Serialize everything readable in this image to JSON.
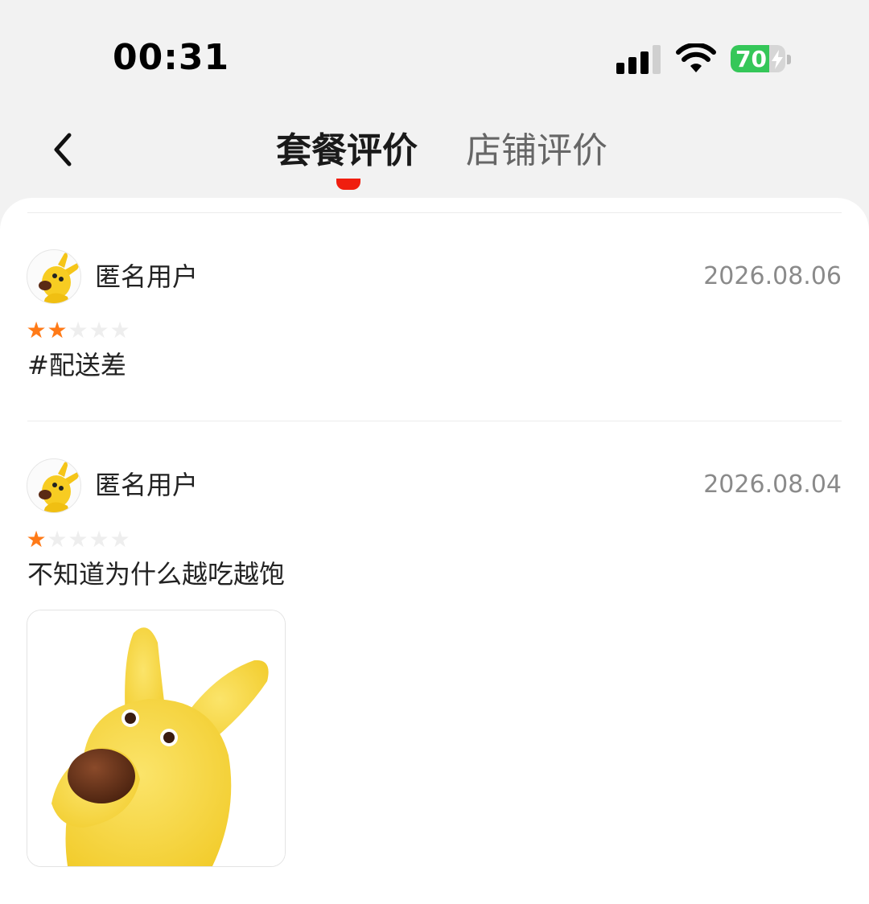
{
  "status_bar": {
    "time": "00:31",
    "battery_percent": 70,
    "battery_label": "70",
    "icons": [
      "signal-icon",
      "wifi-icon",
      "battery-icon",
      "charging-bolt-icon"
    ]
  },
  "nav": {
    "back_icon": "chevron-left-icon",
    "tabs": [
      {
        "label": "套餐评价",
        "active": true
      },
      {
        "label": "店铺评价",
        "active": false
      }
    ],
    "indicator_color": "#f01e0f"
  },
  "reviews": [
    {
      "user": "匿名用户",
      "date": "2026.08.06",
      "rating": 2,
      "max_rating": 5,
      "text": "#配送差"
    },
    {
      "user": "匿名用户",
      "date": "2026.08.04",
      "rating": 1,
      "max_rating": 5,
      "text": "不知道为什么越吃越饱",
      "photo": "yellow-dog-photo"
    }
  ],
  "colors": {
    "star_filled": "#ff7a17",
    "star_empty": "#eeeeee",
    "date": "#8a8a8a",
    "battery": "#35c759"
  }
}
